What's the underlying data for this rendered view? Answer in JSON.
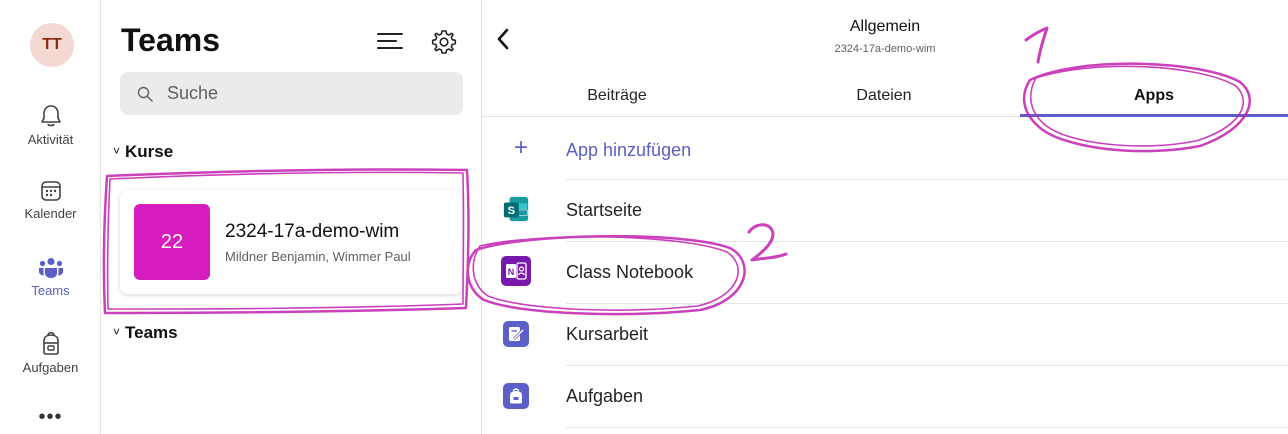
{
  "rail": {
    "avatar_initials": "TT",
    "items": [
      {
        "label": "Aktivität",
        "icon": "bell-icon"
      },
      {
        "label": "Kalender",
        "icon": "calendar-icon"
      },
      {
        "label": "Teams",
        "icon": "teams-icon",
        "active": true
      },
      {
        "label": "Aufgaben",
        "icon": "backpack-icon"
      }
    ],
    "more": "•••"
  },
  "panel": {
    "title": "Teams",
    "search_placeholder": "Suche",
    "sections": [
      {
        "label": "Kurse",
        "chevron": "˅"
      },
      {
        "label": "Teams",
        "chevron": "˅"
      }
    ],
    "team_card": {
      "tile_text": "22",
      "name": "2324-17a-demo-wim",
      "members": "Mildner Benjamin, Wimmer Paul"
    }
  },
  "channel": {
    "title": "Allgemein",
    "subtitle": "2324-17a-demo-wim",
    "tabs": [
      "Beiträge",
      "Dateien",
      "Apps"
    ],
    "active_tab": "Apps",
    "add_app_label": "App hinzufügen",
    "apps": [
      {
        "label": "Startseite",
        "icon": "sharepoint-icon",
        "color": "#036c70"
      },
      {
        "label": "Class Notebook",
        "icon": "onenote-icon",
        "color": "#7719aa"
      },
      {
        "label": "Kursarbeit",
        "icon": "assignment-icon",
        "color": "#5b5fc7"
      },
      {
        "label": "Aufgaben",
        "icon": "backpack-icon",
        "color": "#5b5fc7"
      }
    ]
  },
  "annotations": {
    "marker_1": "1",
    "marker_2": "2",
    "color": "#c21fb0"
  },
  "colors": {
    "accent": "#5b5fc7",
    "team_tile": "#d61bbf",
    "avatar_bg": "#f4d8d2"
  }
}
